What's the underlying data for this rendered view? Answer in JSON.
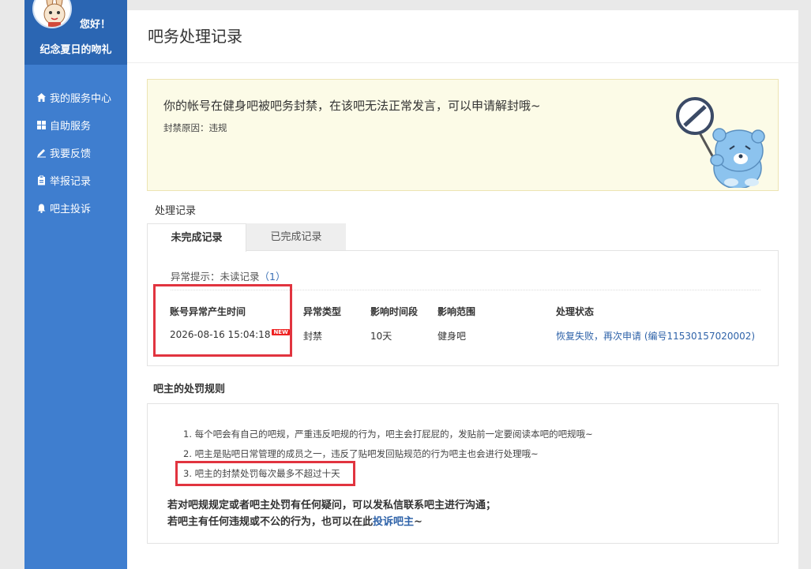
{
  "sidebar": {
    "greeting": "您好！",
    "nickname": "纪念夏日的吻礼",
    "items": [
      {
        "label": "我的服务中心",
        "icon": "home-icon"
      },
      {
        "label": "自助服务",
        "icon": "grid-icon"
      },
      {
        "label": "我要反馈",
        "icon": "edit-icon"
      },
      {
        "label": "举报记录",
        "icon": "clipboard-icon"
      },
      {
        "label": "吧主投诉",
        "icon": "bell-icon"
      }
    ]
  },
  "page": {
    "title": "吧务处理记录"
  },
  "notice": {
    "message": "你的帐号在健身吧被吧务封禁，在该吧无法正常发言，可以申请解封哦~",
    "reason": "封禁原因：违规"
  },
  "records": {
    "section_title": "处理记录",
    "tabs": [
      "未完成记录",
      "已完成记录"
    ],
    "abnormal_label": "异常提示：未读记录",
    "abnormal_count": "（1）",
    "columns": [
      "账号异常产生时间",
      "异常类型",
      "影响时间段",
      "影响范围",
      "处理状态"
    ],
    "row": {
      "time": "2026-08-16 15:04:18",
      "new_badge": "NEW",
      "type": "封禁",
      "duration": "10天",
      "scope": "健身吧",
      "status": "恢复失败，再次申请 (编号11530157020002)"
    }
  },
  "rules": {
    "section_title": "吧主的处罚规则",
    "items": [
      "1. 每个吧会有自己的吧规，严重违反吧规的行为，吧主会打屁屁的，发贴前一定要阅读本吧的吧规哦~",
      "2. 吧主是贴吧日常管理的成员之一，违反了贴吧发回贴规范的行为吧主也会进行处理哦~",
      "3. 吧主的封禁处罚每次最多不超过十天"
    ],
    "contact_line1": "若对吧规规定或者吧主处罚有任何疑问，可以发私信联系吧主进行沟通；",
    "contact_line2_prefix": "若吧主有任何违规或不公的行为，也可以在此",
    "contact_link": "投诉吧主",
    "contact_line2_suffix": "~"
  },
  "colors": {
    "sidebar": "#3f7ecf",
    "sidebar_head": "#2b66b3",
    "highlight_box": "#e1343f",
    "link": "#2f63a9",
    "notice_bg": "#fcfbe7"
  }
}
